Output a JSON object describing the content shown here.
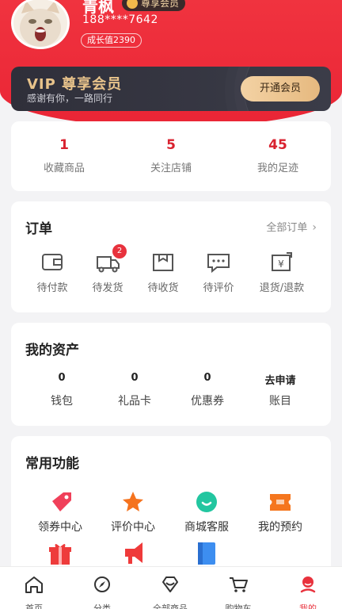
{
  "profile": {
    "name": "青枫",
    "vip_badge": "尊享会员",
    "phone": "188****7642",
    "growth": "成长值2390"
  },
  "vip_card": {
    "title": "VIP 尊享会员",
    "subtitle": "感谢有你，一路同行",
    "button": "开通会员"
  },
  "stats": [
    {
      "value": "1",
      "label": "收藏商品"
    },
    {
      "value": "5",
      "label": "关注店铺"
    },
    {
      "value": "45",
      "label": "我的足迹"
    }
  ],
  "orders": {
    "title": "订单",
    "all_label": "全部订单",
    "items": [
      {
        "label": "待付款",
        "icon": "wallet-icon"
      },
      {
        "label": "待发货",
        "icon": "truck-icon",
        "badge": "2"
      },
      {
        "label": "待收货",
        "icon": "package-icon"
      },
      {
        "label": "待评价",
        "icon": "comment-icon"
      },
      {
        "label": "退货/退款",
        "icon": "refund-icon"
      }
    ]
  },
  "assets": {
    "title": "我的资产",
    "items": [
      {
        "value": "0",
        "label": "钱包"
      },
      {
        "value": "0",
        "label": "礼品卡"
      },
      {
        "value": "0",
        "label": "优惠券"
      },
      {
        "value": "去申请",
        "label": "账目"
      }
    ]
  },
  "functions": {
    "title": "常用功能",
    "items": [
      {
        "label": "领券中心",
        "icon": "coupon-tag-icon",
        "color": "#f0405a"
      },
      {
        "label": "评价中心",
        "icon": "star-icon",
        "color": "#f5731e"
      },
      {
        "label": "商城客服",
        "icon": "service-icon",
        "color": "#22c6a0"
      },
      {
        "label": "我的预约",
        "icon": "ticket-icon",
        "color": "#f5761e"
      },
      {
        "label": "",
        "icon": "gift-icon",
        "color": "#ee3b3b"
      },
      {
        "label": "",
        "icon": "megaphone-icon",
        "color": "#ef3a3a"
      },
      {
        "label": "",
        "icon": "bookmark-icon",
        "color": "#3d8ef0"
      }
    ]
  },
  "tabbar": [
    {
      "label": "首页",
      "icon": "home-icon"
    },
    {
      "label": "分类",
      "icon": "compass-icon"
    },
    {
      "label": "全部商品",
      "icon": "diamond-icon"
    },
    {
      "label": "购物车",
      "icon": "cart-icon"
    },
    {
      "label": "我的",
      "icon": "profile-icon",
      "active": true
    }
  ],
  "colors": {
    "brand": "#e8323d",
    "vip_gold": "#e8c38b"
  }
}
